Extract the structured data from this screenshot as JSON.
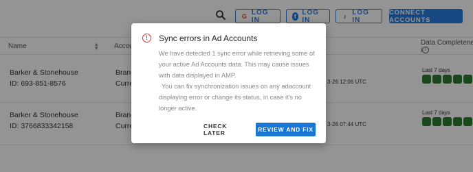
{
  "toolbar": {
    "google_login": "LOG IN",
    "facebook_login": "LOG IN",
    "tiktok_login": "LOG IN",
    "connect_accounts": "CONNECT ACCOUNTS",
    "icons": [
      "search-icon",
      "google-icon",
      "facebook-icon",
      "tiktok-icon"
    ]
  },
  "table": {
    "columns": {
      "name": "Name",
      "account": "Accou",
      "data_completeness": "Data Completeness i"
    },
    "rows": [
      {
        "name": "Barker & Stonehouse",
        "id": "ID: 693-851-8576",
        "account_line1": "Brand",
        "account_line2": "Curre",
        "last_sync": "3-26 12:06 UTC",
        "completeness_label": "Last 7 days",
        "completeness_days": 7
      },
      {
        "name": "Barker & Stonehouse",
        "id": "ID: 3766833342158",
        "account_line1": "Brand",
        "account_line2": "Curre",
        "last_sync": "3-26 07:44 UTC",
        "completeness_label": "Last 7 days",
        "completeness_days": 7
      }
    ]
  },
  "modal": {
    "title": "Sync errors in Ad Accounts",
    "body_p1": "We have detected 1 sync error while retrieving some of your active Ad Accounts data. This may cause issues with data displayed in AMP.",
    "body_p2": "You can fix synchronization issues on any adaccount displaying error or change its status, in case it's no longer active.",
    "check_later": "CHECK LATER",
    "review_fix": "REVIEW AND FIX"
  },
  "colors": {
    "accent": "#2a7de1",
    "primary_button": "#1976d2",
    "error": "#d32f2f",
    "status_green": "#2e7d32"
  }
}
